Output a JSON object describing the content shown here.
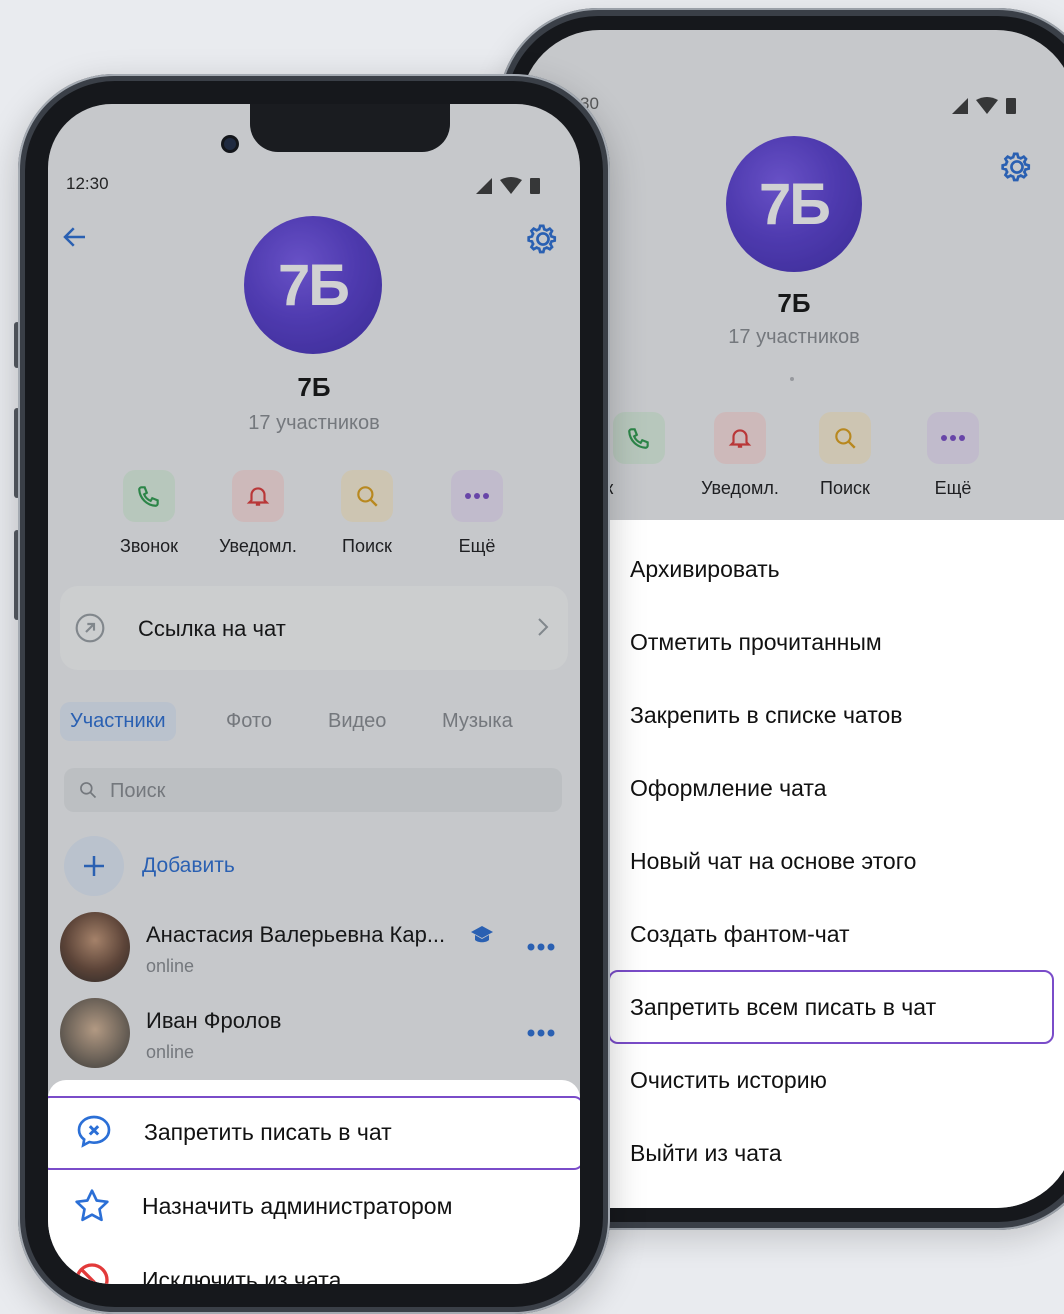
{
  "status": {
    "time": "12:30",
    "time_partial": "30"
  },
  "chat": {
    "avatar_text": "7Б",
    "name": "7Б",
    "members": "17 участников"
  },
  "actions": [
    {
      "label": "Звонок",
      "icon": "phone-icon",
      "color": "#2e9e4f",
      "bg": "#dff2e3"
    },
    {
      "label": "Уведомл.",
      "icon": "bell-icon",
      "color": "#e23a3a",
      "bg": "#fbe1e1"
    },
    {
      "label": "Поиск",
      "icon": "search-icon",
      "color": "#e0a21a",
      "bg": "#fbf0d6"
    },
    {
      "label": "Ещё",
      "icon": "more-icon",
      "color": "#7a4cc9",
      "bg": "#ece3f8"
    }
  ],
  "back_phone": {
    "action_call_partial": "вонок",
    "menu": [
      "Архивировать",
      "Отметить прочитанным",
      "Закрепить в списке чатов",
      "Оформление чата",
      "Новый чат на основе этого",
      "Создать фантом-чат",
      "Запретить всем писать в чат",
      "Очистить историю",
      "Выйти из чата"
    ]
  },
  "front_phone": {
    "chat_link": "Ссылка на чат",
    "tabs": [
      "Участники",
      "Фото",
      "Видео",
      "Музыка"
    ],
    "search_placeholder": "Поиск",
    "add_label": "Добавить",
    "members": [
      {
        "name": "Анастасия Валерьевна Кар...",
        "status": "online"
      },
      {
        "name": "Иван Фролов",
        "status": "online"
      }
    ],
    "sheet": [
      {
        "label": "Запретить писать в чат",
        "icon": "mute-chat-icon"
      },
      {
        "label": "Назначить администратором",
        "icon": "star-icon"
      },
      {
        "label": "Исключить из чата",
        "icon": "ban-icon"
      }
    ]
  },
  "colors": {
    "accent": "#2b6fd6",
    "highlight": "#7a4cc9",
    "avatar": "#5a3fd3"
  }
}
